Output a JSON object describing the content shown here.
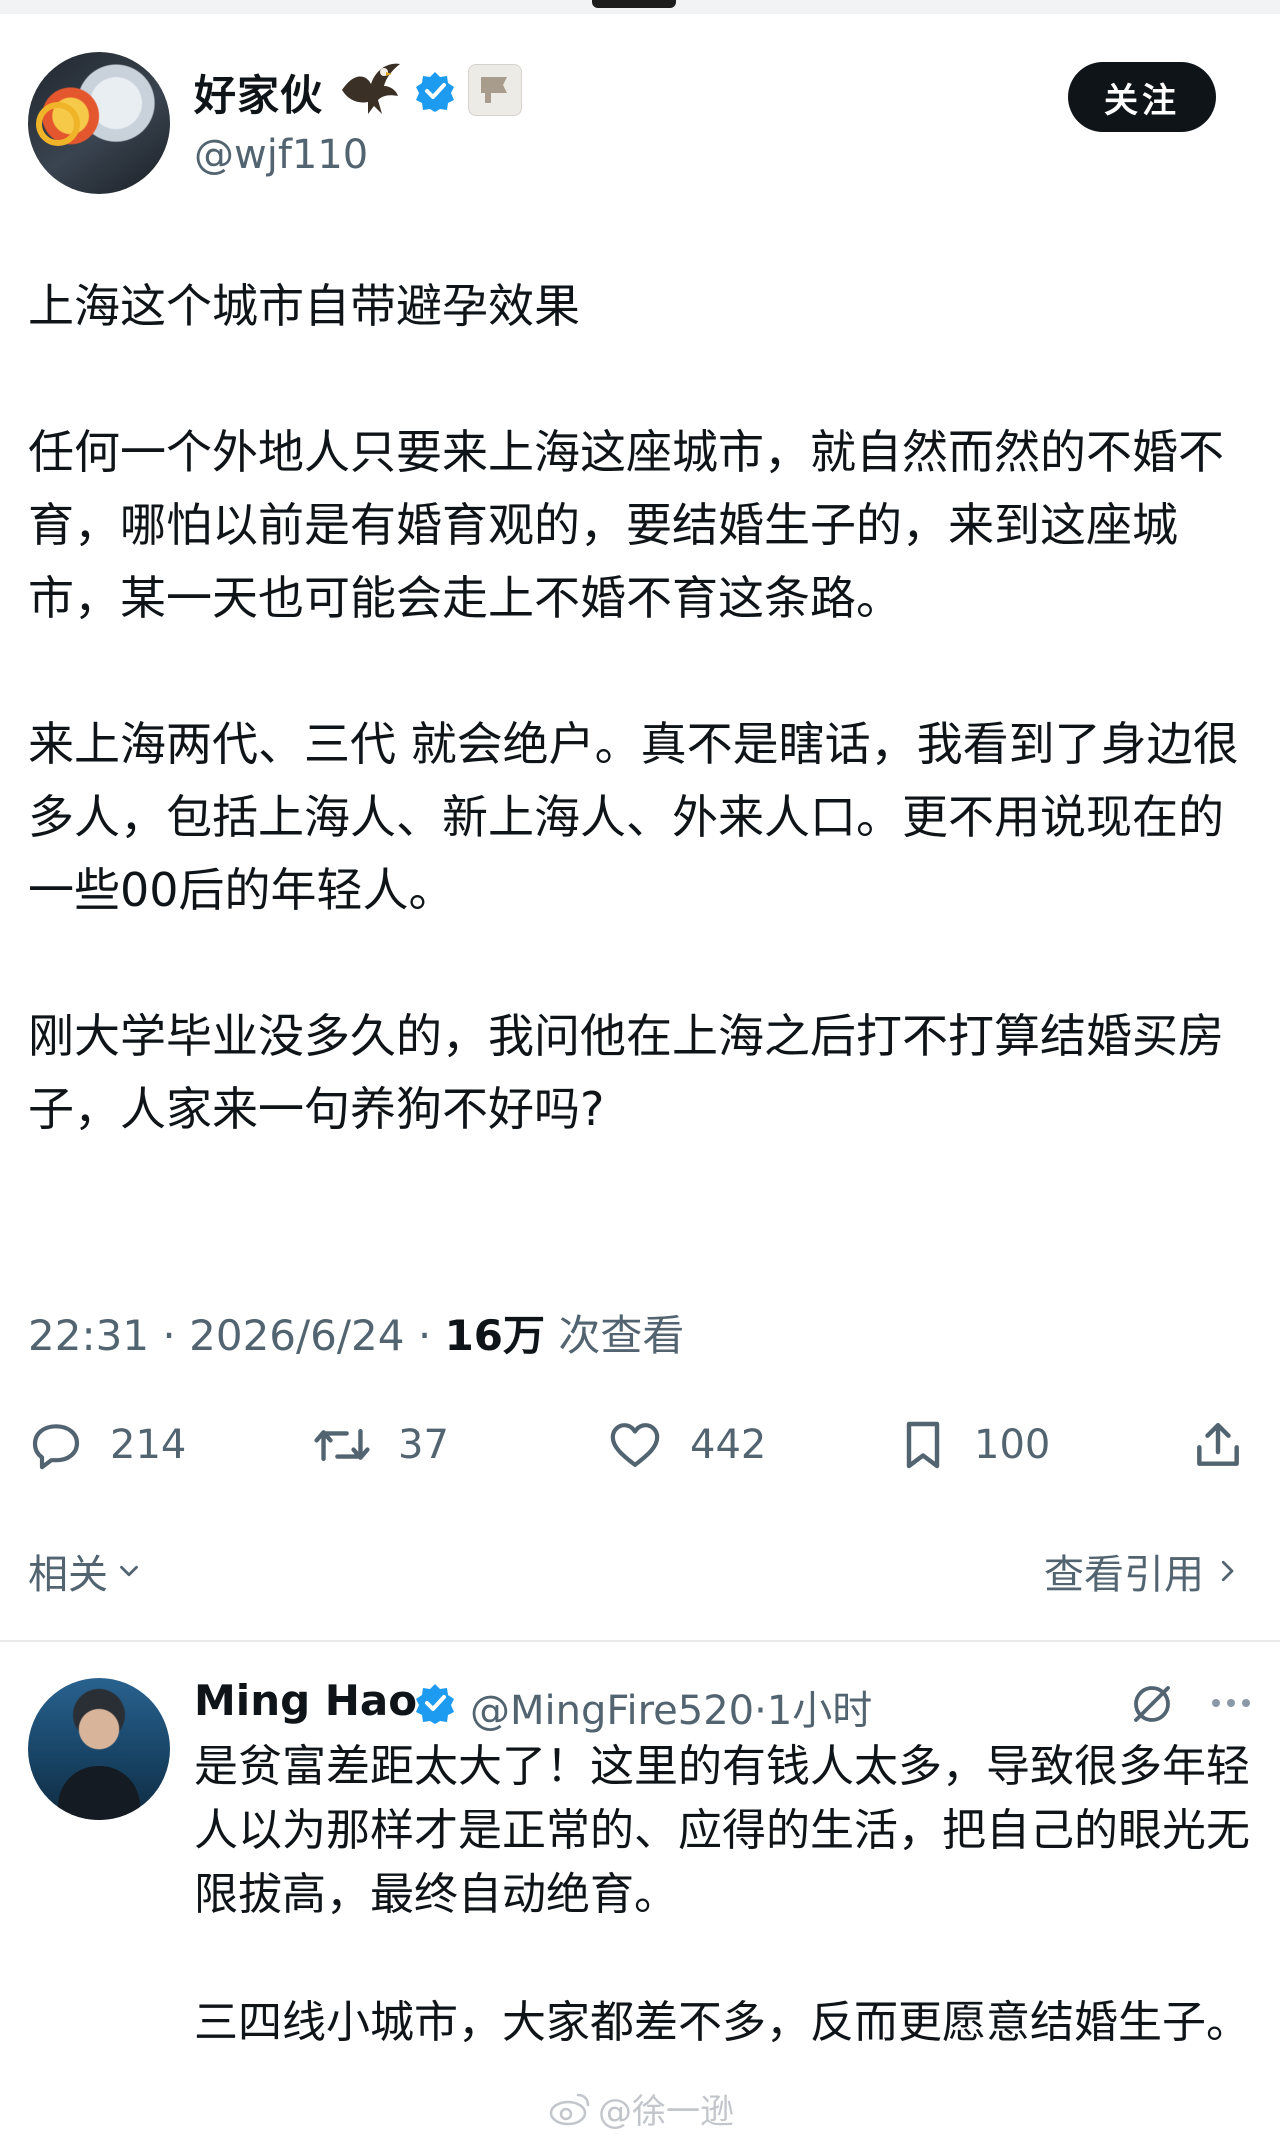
{
  "post": {
    "author": {
      "name": "好家伙",
      "handle": "@wjf110",
      "emoji_icons": [
        "eagle-icon",
        "verified-icon",
        "flag-icon"
      ]
    },
    "follow_label": "关注",
    "paragraphs": [
      "上海这个城市自带避孕效果",
      "任何一个外地人只要来上海这座城市，就自然而然的不婚不育，哪怕以前是有婚育观的，要结婚生子的，来到这座城市，某一天也可能会走上不婚不育这条路。",
      "来上海两代、三代 就会绝户。真不是瞎话，我看到了身边很多人，包括上海人、新上海人、外来人口。更不用说现在的一些00后的年轻人。",
      "刚大学毕业没多久的，我问他在上海之后打不打算结婚买房子，人家来一句养狗不好吗?"
    ],
    "time": "22:31",
    "date": "2026/6/24",
    "views_count": "16万",
    "views_label": "次查看",
    "separator": "·",
    "stats": {
      "replies": "214",
      "reposts": "37",
      "likes": "442",
      "bookmarks": "100"
    },
    "related_label": "相关",
    "quotes_label": "查看引用"
  },
  "reply": {
    "name": "Ming Hao",
    "handle": "@MingFire520",
    "time": "1小时",
    "separator": "·",
    "paragraphs": [
      "是贫富差距太大了！这里的有钱人太多，导致很多年轻人以为那样才是正常的、应得的生活，把自己的眼光无限拔高，最终自动绝育。",
      "三四线小城市，大家都差不多，反而更愿意结婚生子。"
    ]
  },
  "watermark": "@徐一逊",
  "colors": {
    "text": "#0f1419",
    "secondary": "#536471",
    "verified": "#1d9bf0",
    "button_bg": "#0f1419",
    "divider": "#e7e9ea"
  }
}
